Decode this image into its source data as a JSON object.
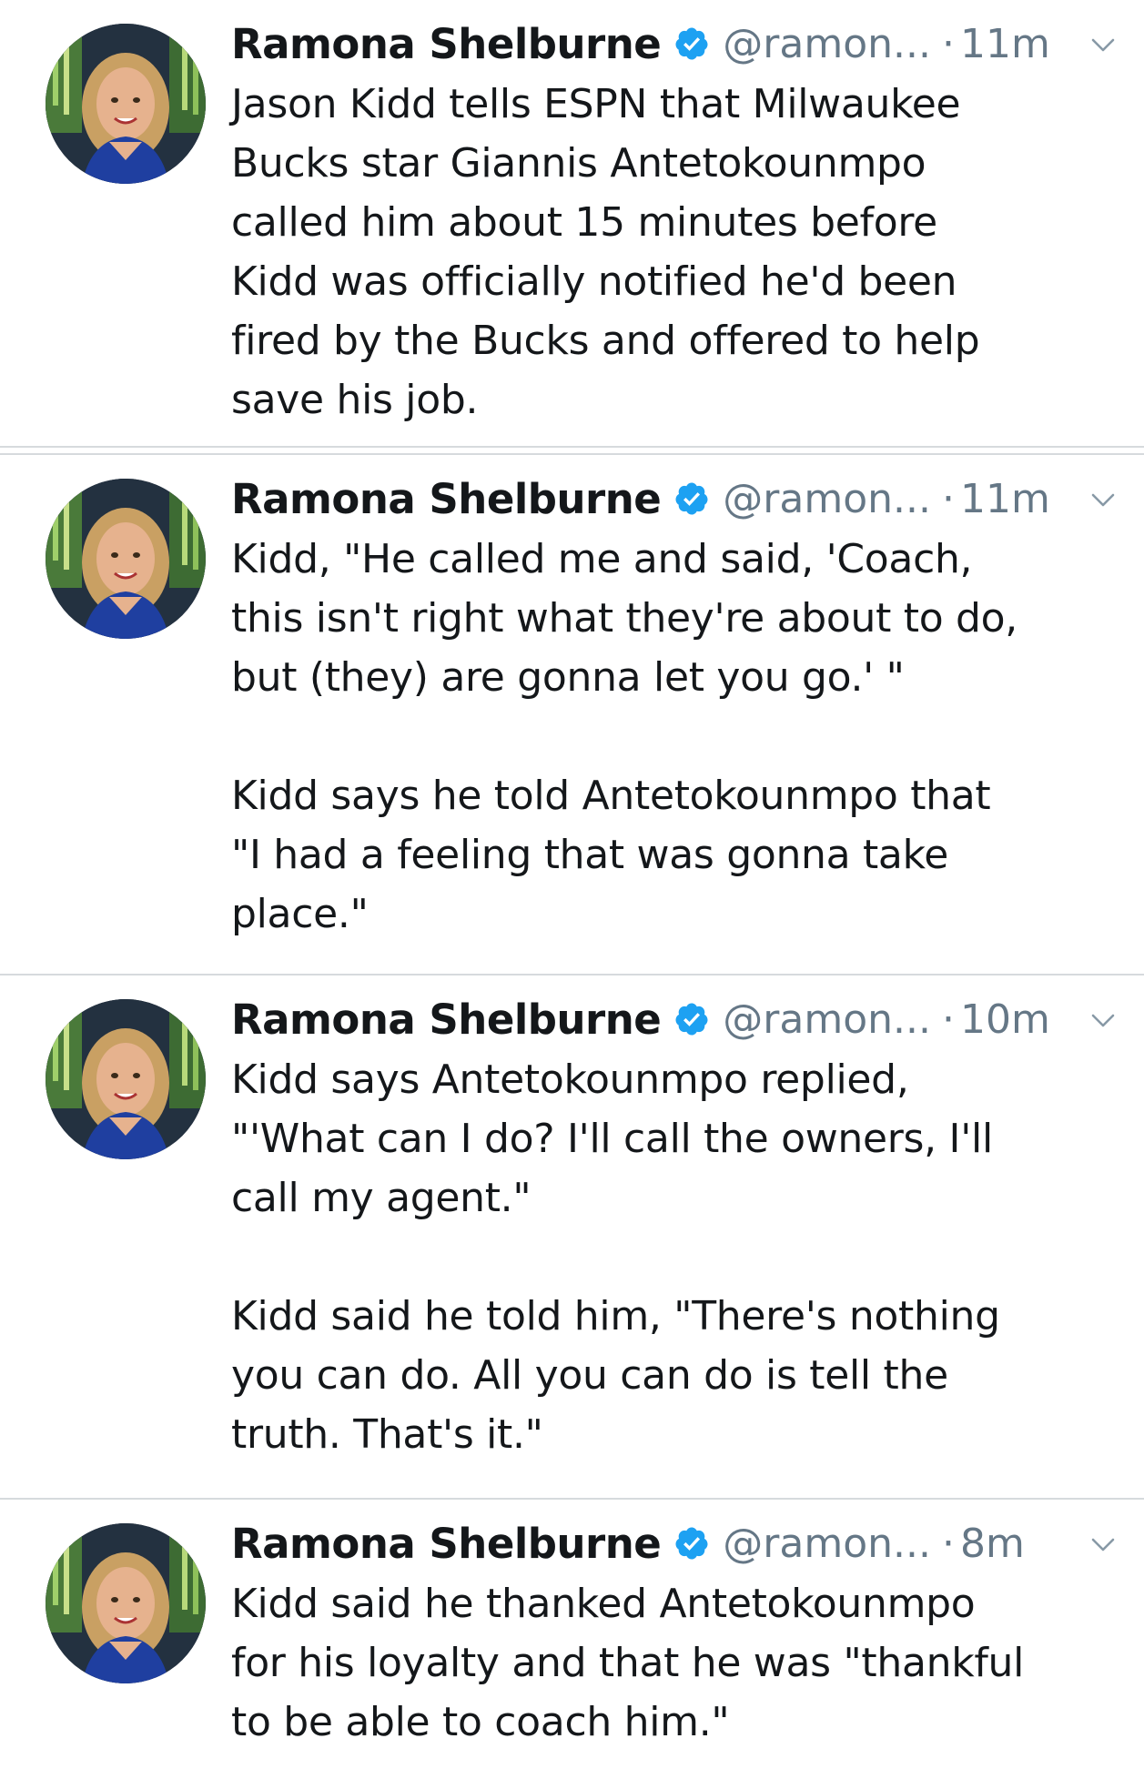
{
  "tweets": [
    {
      "author_name": "Ramona Shelburne",
      "handle": "@ramon...",
      "separator": "·",
      "time": "11m",
      "verified": true,
      "text": "Jason Kidd tells ESPN that Milwaukee\nBucks star Giannis Antetokounmpo\ncalled him about 15 minutes before\nKidd was officially notified he'd been\nfired by the Bucks and offered to help\nsave his job."
    },
    {
      "author_name": "Ramona Shelburne",
      "handle": "@ramon...",
      "separator": "·",
      "time": "11m",
      "verified": true,
      "text": "Kidd, \"He called me and said, 'Coach,\nthis isn't right what they're about to do,\nbut (they) are gonna let you go.' \"\n\nKidd says he told Antetokounmpo that\n\"I had a feeling that was gonna take\nplace.\""
    },
    {
      "author_name": "Ramona Shelburne",
      "handle": "@ramon...",
      "separator": "·",
      "time": "10m",
      "verified": true,
      "text": "Kidd says Antetokounmpo replied,\n\"'What can I do? I'll call the owners, I'll\ncall my agent.\"\n\nKidd said he told him, \"There's nothing\nyou can do. All you can do is tell the\ntruth. That's it.\""
    },
    {
      "author_name": "Ramona Shelburne",
      "handle": "@ramon...",
      "separator": "·",
      "time": "8m",
      "verified": true,
      "text": "Kidd said he thanked Antetokounmpo\nfor his loyalty and that he was \"thankful\nto be able to coach him.\""
    }
  ],
  "colors": {
    "verified_badge": "#1da1f2",
    "secondary_text": "#657786",
    "primary_text": "#14171a",
    "divider": "#d6dadd"
  },
  "icons": {
    "verified": "verified-badge-icon",
    "menu": "chevron-down-icon",
    "avatar": "profile-photo"
  }
}
